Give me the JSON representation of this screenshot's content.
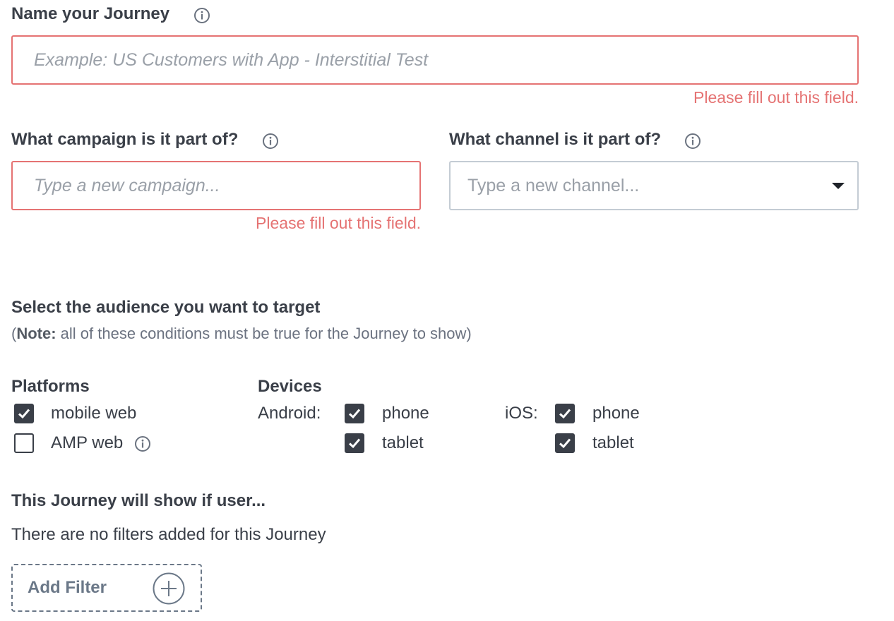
{
  "journey_name": {
    "label": "Name your Journey",
    "placeholder": "Example: US Customers with App - Interstitial Test",
    "error": "Please fill out this field.",
    "info_icon": "info-icon"
  },
  "campaign": {
    "label": "What campaign is it part of?",
    "placeholder": "Type a new campaign...",
    "error": "Please fill out this field.",
    "info_icon": "info-icon"
  },
  "channel": {
    "label": "What channel is it part of?",
    "placeholder": "Type a new channel...",
    "dropdown_icon": "caret-down-icon",
    "info_icon": "info-icon"
  },
  "audience": {
    "title": "Select the audience you want to target",
    "note_open": "(",
    "note_bold": "Note:",
    "note_text": " all of these conditions must be true for the Journey to show)"
  },
  "platforms": {
    "title": "Platforms",
    "items": [
      {
        "label": "mobile web",
        "checked": true
      },
      {
        "label": "AMP web",
        "checked": false,
        "info_icon": "info-icon"
      }
    ]
  },
  "devices": {
    "title": "Devices",
    "android": {
      "label": "Android:",
      "items": [
        {
          "label": "phone",
          "checked": true
        },
        {
          "label": "tablet",
          "checked": true
        }
      ]
    },
    "ios": {
      "label": "iOS:",
      "items": [
        {
          "label": "phone",
          "checked": true
        },
        {
          "label": "tablet",
          "checked": true
        }
      ]
    }
  },
  "filters": {
    "title": "This Journey will show if user...",
    "empty_text": "There are no filters added for this Journey",
    "add_button_label": "Add Filter",
    "add_icon": "plus-circle-icon"
  },
  "colors": {
    "error": "#e57373",
    "text": "#3a3f48",
    "border_neutral": "#c4ccd4",
    "muted": "#6b7888"
  }
}
